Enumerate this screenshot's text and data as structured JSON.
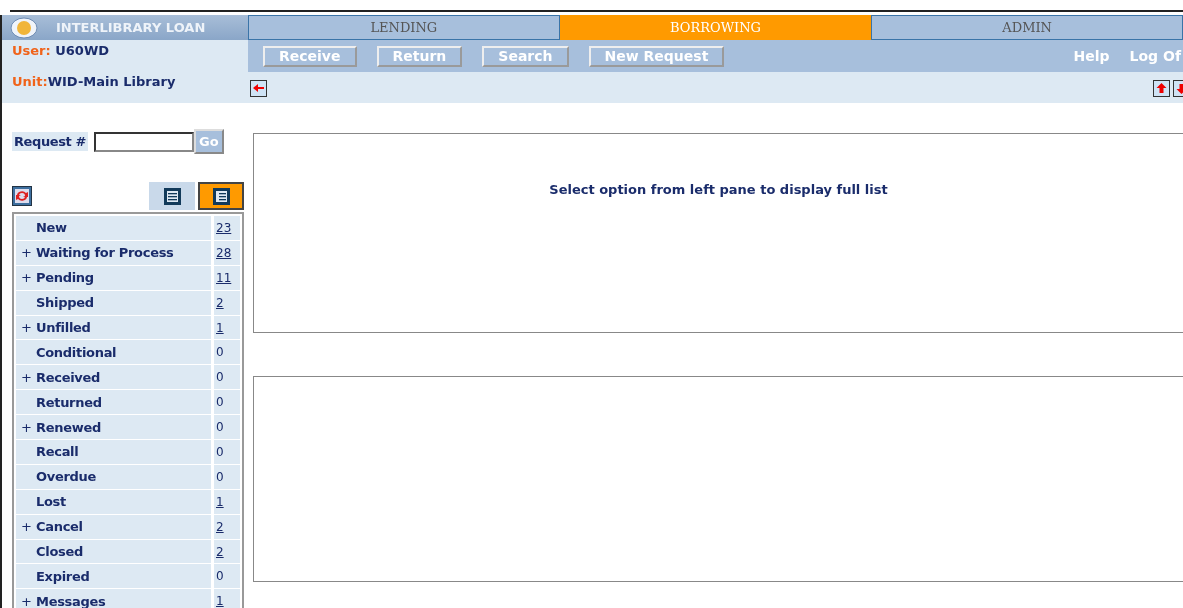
{
  "app": {
    "title": "INTERLIBRARY LOAN"
  },
  "tabs": [
    {
      "label": "LENDING",
      "selected": false
    },
    {
      "label": "BORROWING",
      "selected": true
    },
    {
      "label": "ADMIN",
      "selected": false
    }
  ],
  "user": {
    "label": "User: ",
    "value": "U60WD"
  },
  "unit": {
    "label": "Unit:",
    "value": "WID-Main Library"
  },
  "actions": [
    "Receive",
    "Return",
    "Search",
    "New Request"
  ],
  "links": [
    "Help",
    "Log Of"
  ],
  "request": {
    "label": "Request #",
    "button": "Go"
  },
  "views": [
    {
      "selected": false
    },
    {
      "selected": true
    }
  ],
  "statuses": [
    {
      "name": "New",
      "count": "23",
      "linked": true
    },
    {
      "toggle": "+",
      "name": "Waiting for Process",
      "count": "28",
      "linked": true
    },
    {
      "toggle": "+",
      "name": "Pending",
      "count": "11",
      "linked": true
    },
    {
      "name": "Shipped",
      "count": "2",
      "linked": true
    },
    {
      "toggle": "+",
      "name": "Unfilled",
      "count": "1",
      "linked": true
    },
    {
      "name": "Conditional",
      "count": "0",
      "linked": false
    },
    {
      "toggle": "+",
      "name": "Received",
      "count": "0",
      "linked": false
    },
    {
      "name": "Returned",
      "count": "0",
      "linked": false
    },
    {
      "toggle": "+",
      "name": "Renewed",
      "count": "0",
      "linked": false
    },
    {
      "name": "Recall",
      "count": "0",
      "linked": false
    },
    {
      "name": "Overdue",
      "count": "0",
      "linked": false
    },
    {
      "name": "Lost",
      "count": "1",
      "linked": true
    },
    {
      "toggle": "+",
      "name": "Cancel",
      "count": "2",
      "linked": true
    },
    {
      "name": "Closed",
      "count": "2",
      "linked": true
    },
    {
      "name": "Expired",
      "count": "0",
      "linked": false
    },
    {
      "toggle": "+",
      "name": "Messages",
      "count": "1",
      "linked": true
    }
  ],
  "list_pane": {
    "message": "Select option from left pane to display full list"
  }
}
